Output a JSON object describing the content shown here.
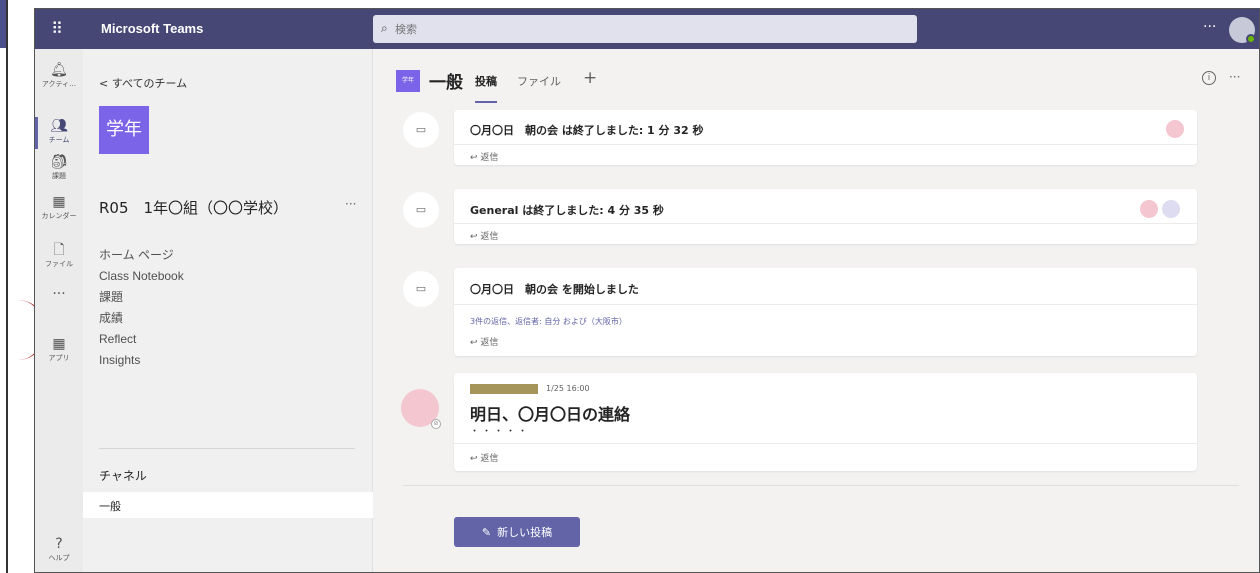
{
  "topbar": {
    "app_title": "Microsoft Teams",
    "search_placeholder": "検索",
    "more": "···"
  },
  "rail": [
    {
      "label": "アクティ…",
      "icon": "bell-icon"
    },
    {
      "label": "チーム",
      "icon": "teams-icon"
    },
    {
      "label": "課題",
      "icon": "assignments-icon"
    },
    {
      "label": "カレンダー",
      "icon": "calendar-icon"
    },
    {
      "label": "ファイル",
      "icon": "file-icon"
    },
    {
      "label": "···",
      "icon": "more-icon"
    },
    {
      "label": "アプリ",
      "icon": "apps-icon"
    },
    {
      "label": "ヘルプ",
      "icon": "help-icon"
    }
  ],
  "team_panel": {
    "back_label": "< すべてのチーム",
    "tile_text": "学年",
    "team_name": "R05　1年〇組（〇〇学校）",
    "team_more": "···",
    "nav": [
      "ホーム ページ",
      "Class Notebook",
      "課題",
      "成績",
      "Reflect",
      "Insights"
    ],
    "channels_header": "チャネル",
    "channel": "一般"
  },
  "channel_header": {
    "tile_text": "学年",
    "title": "一般",
    "tab_posts": "投稿",
    "tab_files": "ファイル",
    "tab_add": "+",
    "more": "···"
  },
  "messages": [
    {
      "title": "〇月〇日　朝の会 は終了しました: 1 分 32 秒",
      "reply": "↩ 返信"
    },
    {
      "title": "General は終了しました: 4 分 35 秒",
      "reply": "↩ 返信"
    },
    {
      "title": "〇月〇日　朝の会 を開始しました",
      "replies_link": "3件の返信、返信者: 自分 および（大阪市）",
      "reply": "↩ 返信"
    }
  ],
  "post": {
    "time": "1/25 16:00",
    "title": "明日、〇月〇日の連絡",
    "dots": "・・・・・",
    "reply": "↩ 返信"
  },
  "new_post_button": "新しい投稿",
  "colors": {
    "topbar": "#464775",
    "accent": "#6264a7",
    "team_tile": "#7b64e8"
  }
}
